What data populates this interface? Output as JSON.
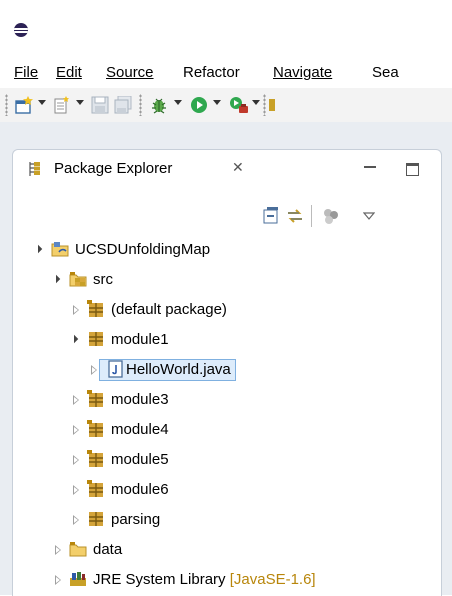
{
  "menu": [
    "File",
    "Edit",
    "Source",
    "Refactor",
    "Navigate",
    "Sea"
  ],
  "view": {
    "title": "Package Explorer",
    "close_glyph": "✕"
  },
  "tree": [
    {
      "label": "UCSDUnfoldingMap",
      "icon": "java-project-icon",
      "state": "open"
    },
    {
      "label": "src",
      "icon": "source-folder-icon",
      "state": "open"
    },
    {
      "label": "(default package)",
      "icon": "package-icon",
      "state": "closed"
    },
    {
      "label": "module1",
      "icon": "package-icon",
      "state": "open"
    },
    {
      "label": "HelloWorld.java",
      "icon": "java-file-icon",
      "state": "closed",
      "selected": true
    },
    {
      "label": "module3",
      "icon": "package-icon",
      "state": "closed"
    },
    {
      "label": "module4",
      "icon": "package-icon",
      "state": "closed"
    },
    {
      "label": "module5",
      "icon": "package-icon",
      "state": "closed"
    },
    {
      "label": "module6",
      "icon": "package-icon",
      "state": "closed"
    },
    {
      "label": "parsing",
      "icon": "package-icon",
      "state": "closed"
    },
    {
      "label": "data",
      "icon": "folder-icon",
      "state": "closed"
    },
    {
      "label": "JRE System Library",
      "suffix": "[JavaSE-1.6]",
      "icon": "library-icon",
      "state": "closed"
    }
  ],
  "colors": {
    "selection": "#ddecfb",
    "package": "#c8a027",
    "decoration": "#b8860b"
  }
}
